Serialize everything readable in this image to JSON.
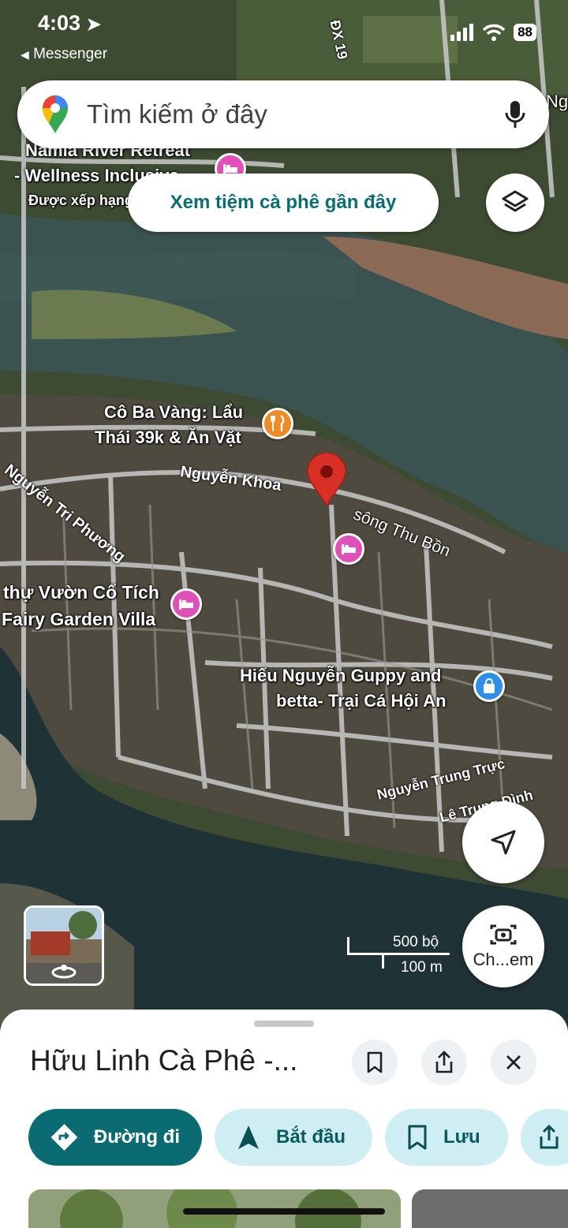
{
  "status_bar": {
    "time": "4:03",
    "back_app": "Messenger",
    "battery": "88"
  },
  "search": {
    "placeholder": "Tìm kiếm ở đây"
  },
  "suggestion_chip": "Xem tiệm cà phê gần đây",
  "map": {
    "road_labels": {
      "dx19": "ĐX 19",
      "nguyen_khoa": "Nguyễn Khoa",
      "nguyen_tri_phuong": "Nguyễn Tri Phương",
      "song_thu_bon": "sông Thu Bồn",
      "nguyen_trung_truc": "Nguyễn Trung Trực",
      "le_trung_dinh": "Lê Trung Đình"
    },
    "places": {
      "namia_line1": "Namia River Retreat",
      "namia_line2": "- Wellness Inclusive",
      "namia_sub": "Được xếp hạng",
      "coba_line1": "Cô Ba Vàng: Lẩu",
      "coba_line2": "Thái 39k & Ăn Vặt",
      "villa_line1": "thự Vườn Cổ Tích",
      "villa_line2": "Fairy Garden Villa",
      "guppy_line1": "Hiếu Nguyễn Guppy and",
      "guppy_line2": "betta- Trại Cá Hội An"
    },
    "edge_text": "Ng Re",
    "scale_ft": "500 bộ",
    "scale_m": "100 m",
    "camera_label": "Ch...em"
  },
  "sheet": {
    "title": "Hữu Linh Cà Phê -...",
    "actions": {
      "directions": "Đường đi",
      "start": "Bắt đầu",
      "save": "Lưu"
    }
  },
  "colors": {
    "accent_teal": "#0b6b72",
    "chip_text": "#0b6d74",
    "action_bg": "#cfeef4",
    "pin_red": "#d93025",
    "hotel_pin": "#e050b8",
    "food_pin": "#f08a24",
    "shop_pin": "#2f8fe8"
  }
}
